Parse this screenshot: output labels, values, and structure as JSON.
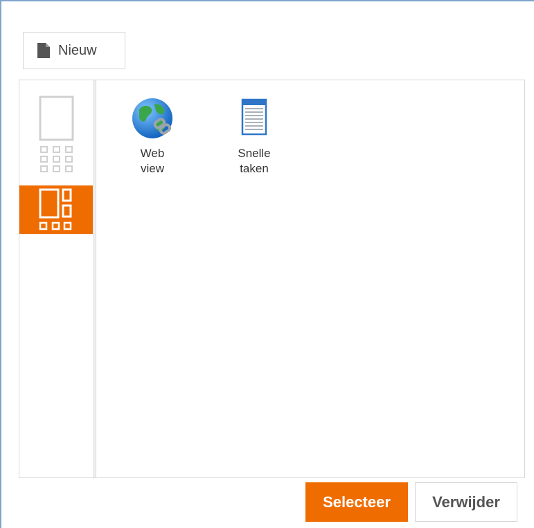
{
  "toolbar": {
    "new_label": "Nieuw",
    "new_icon": "document-icon"
  },
  "layout_options": [
    {
      "name": "single-column-with-grid",
      "selected": false
    },
    {
      "name": "column-with-side-grid",
      "selected": true
    }
  ],
  "tiles": [
    {
      "label": "Web\nview",
      "icon": "globe-link-icon"
    },
    {
      "label": "Snelle\ntaken",
      "icon": "list-window-icon"
    }
  ],
  "actions": {
    "select_label": "Selecteer",
    "delete_label": "Verwijder"
  },
  "colors": {
    "accent": "#ef6c00",
    "frame_border": "#7ea6cc",
    "border": "#d6d6d6"
  }
}
